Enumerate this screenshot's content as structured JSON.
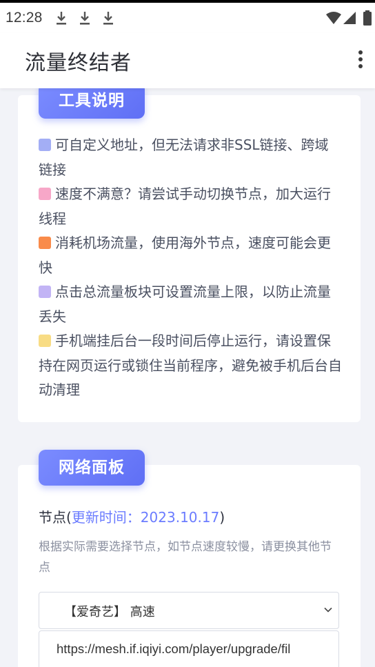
{
  "status_bar": {
    "time": "12:28",
    "icons": [
      "download-icon",
      "download-icon",
      "download-icon",
      "wifi-icon",
      "signal-icon",
      "battery-icon"
    ]
  },
  "appbar": {
    "title": "流量终结者",
    "menu_icon": "more-vert-icon"
  },
  "tools_card": {
    "title": "工具说明",
    "tips": [
      {
        "color": "#a3aef5",
        "text": "可自定义地址，但无法请求非SSL链接、跨域链接"
      },
      {
        "color": "#f7a7c8",
        "text": "速度不满意？请尝试手动切换节点，加大运行线程"
      },
      {
        "color": "#f98b4a",
        "text": "消耗机场流量，使用海外节点，速度可能会更快"
      },
      {
        "color": "#c2b4f5",
        "text": "点击总流量板块可设置流量上限，以防止流量丢失"
      },
      {
        "color": "#f8dc84",
        "text": "手机端挂后台一段时间后停止运行，请设置保持在网页运行或锁住当前程序，避免被手机后台自动清理"
      }
    ]
  },
  "network_card": {
    "title": "网络面板",
    "node_label": "节点(",
    "update_text": "更新时间：2023.10.17",
    "node_label_end": ")",
    "description": "根据实际需要选择节点，如节点速度较慢，请更换其他节点",
    "selected_node": "【爱奇艺】 高速",
    "url": "https://mesh.if.iqiyi.com/player/upgrade/fil"
  },
  "colors": {
    "accent": "#6b7cff",
    "background": "#f2f3f8"
  }
}
